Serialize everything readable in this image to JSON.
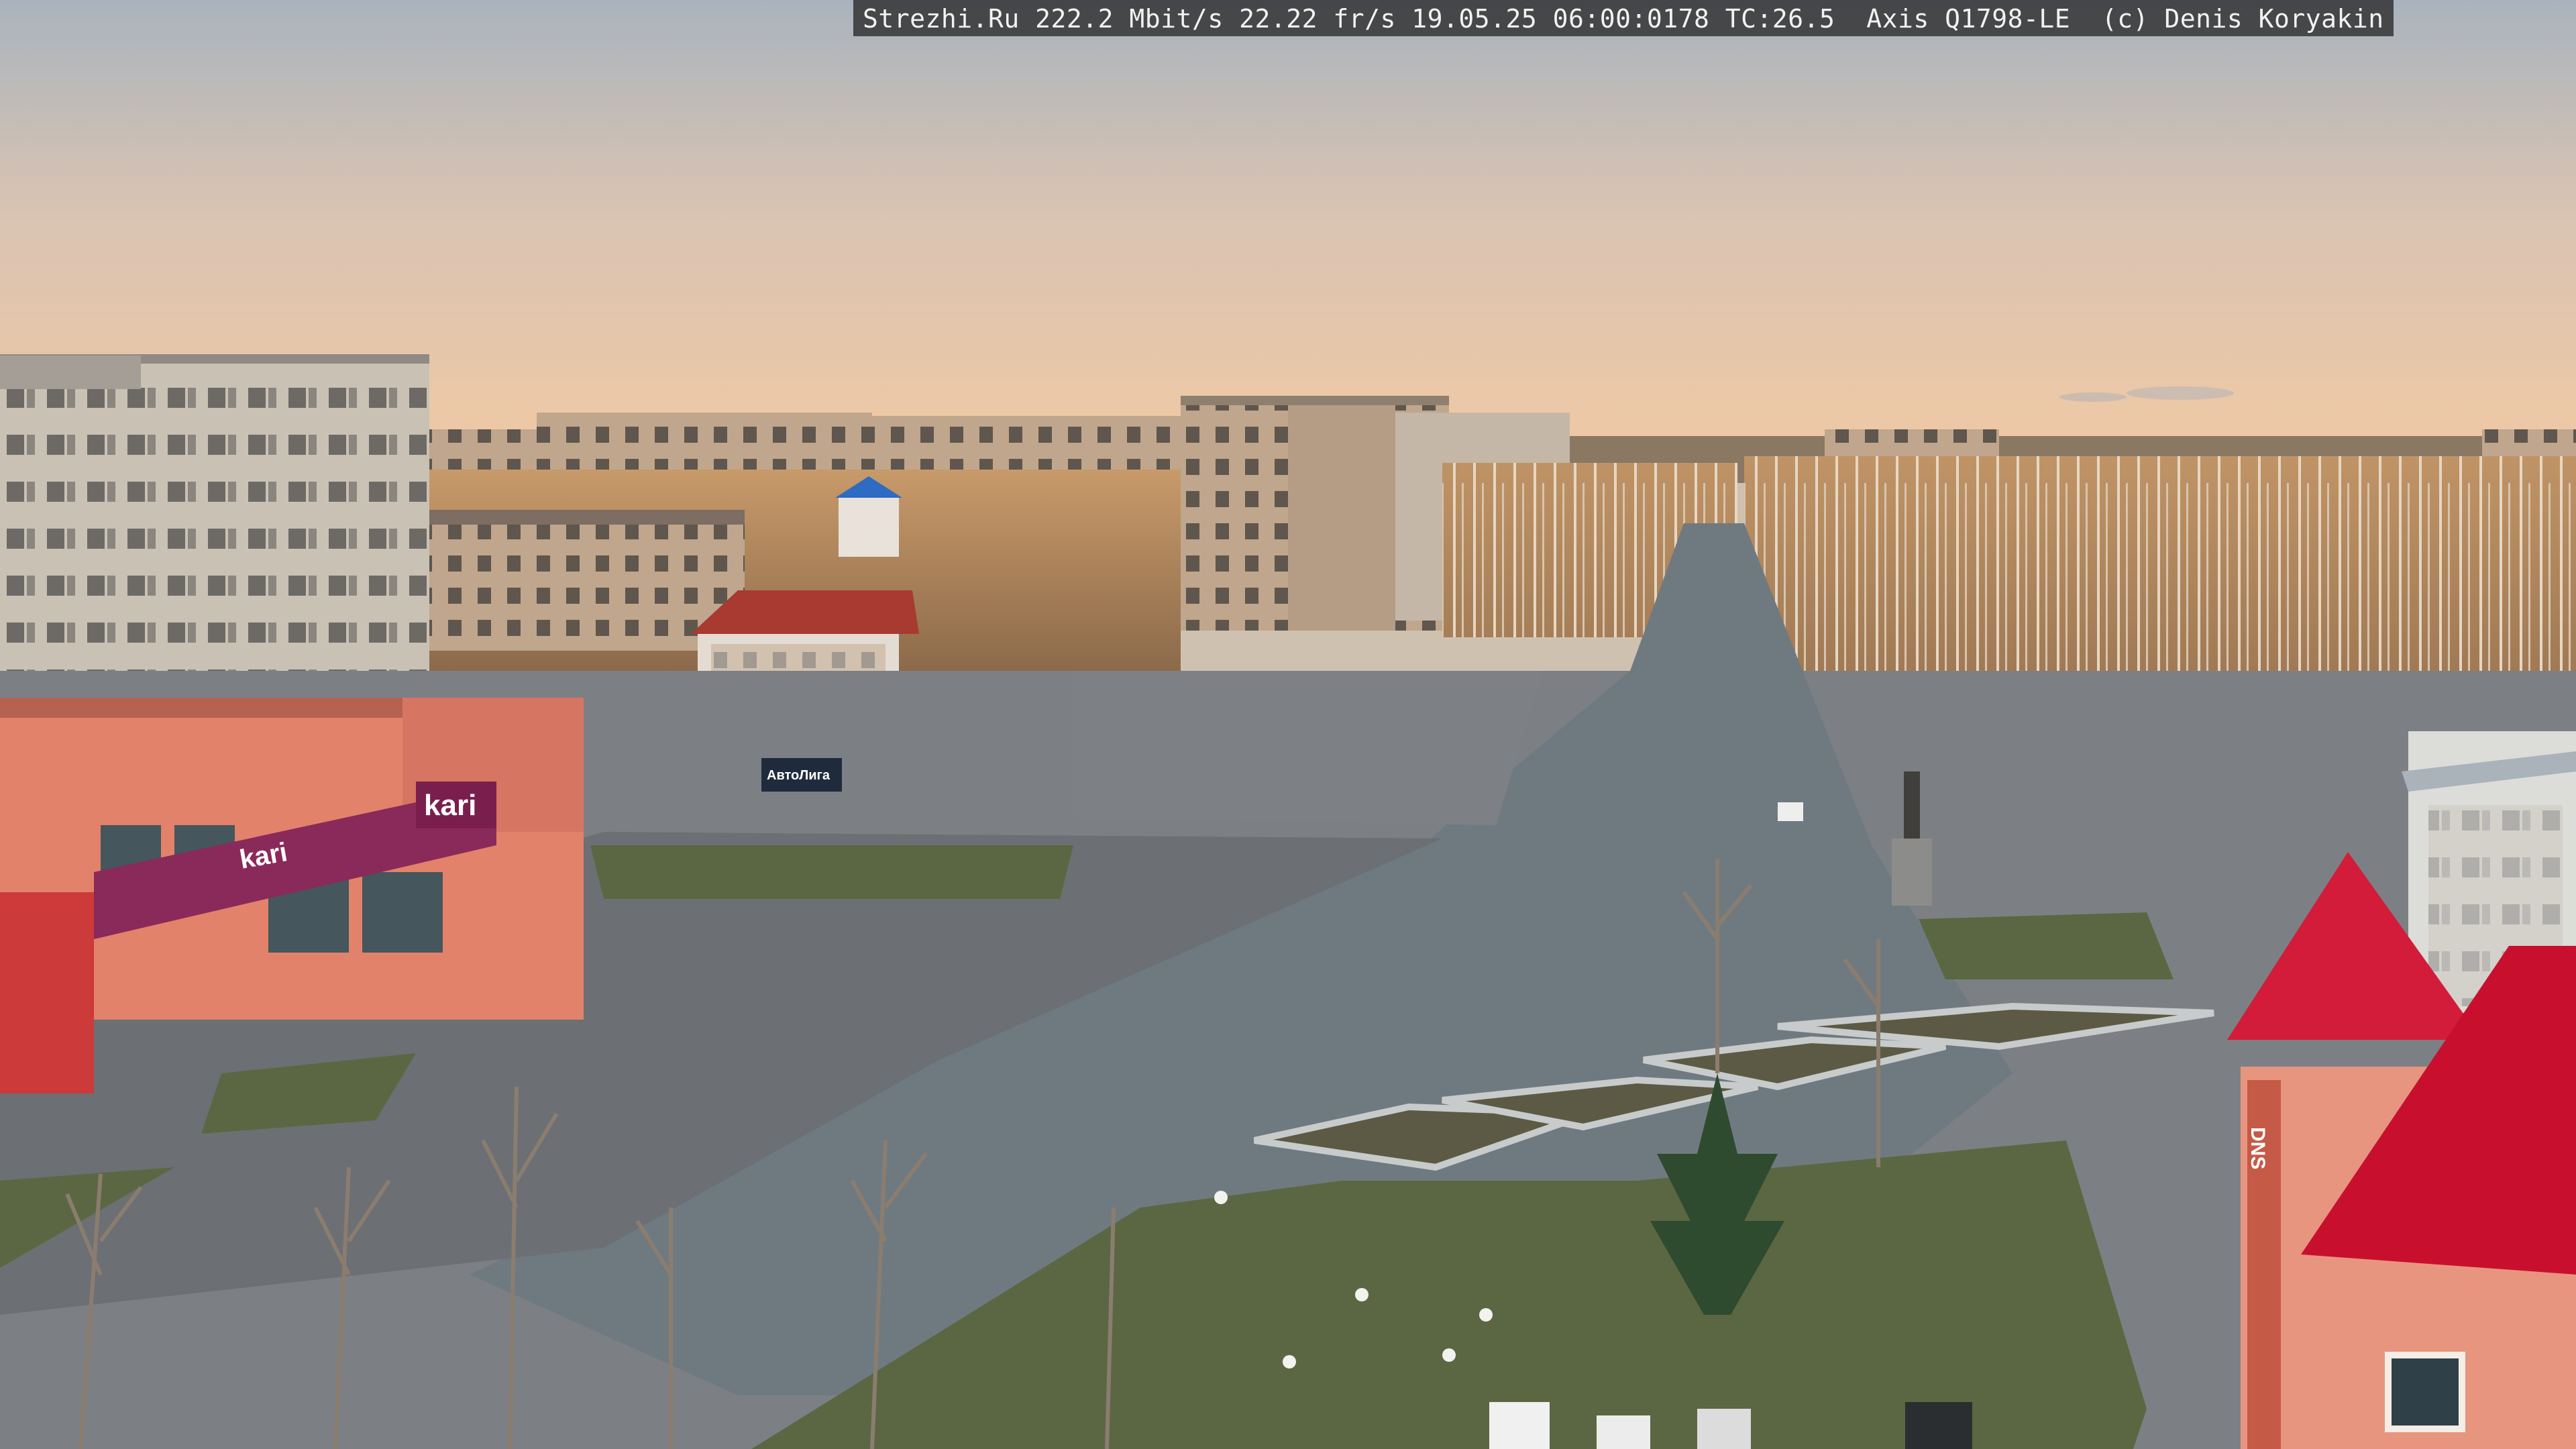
{
  "camera_overlay": {
    "text": "Strezhi.Ru 222.2 Mbit/s 22.22 fr/s 19.05.25 06:00:0178 TC:26.5  Axis Q1798-LE  (c) Denis Koryakin"
  },
  "signs": {
    "store_brand": "kari",
    "store_brand_banner": "kari",
    "dns_letters": "DNS",
    "sign_autoline": "АвтоЛига"
  },
  "colors": {
    "sky_top": "#a9b3bd",
    "sky_horizon": "#f0c9a4",
    "road": "#6f7a80",
    "kari_banner": "#8a2a5a",
    "roof_red": "#c8102e",
    "building_beige": "#c9b8a2",
    "lawn": "#5b6742"
  }
}
